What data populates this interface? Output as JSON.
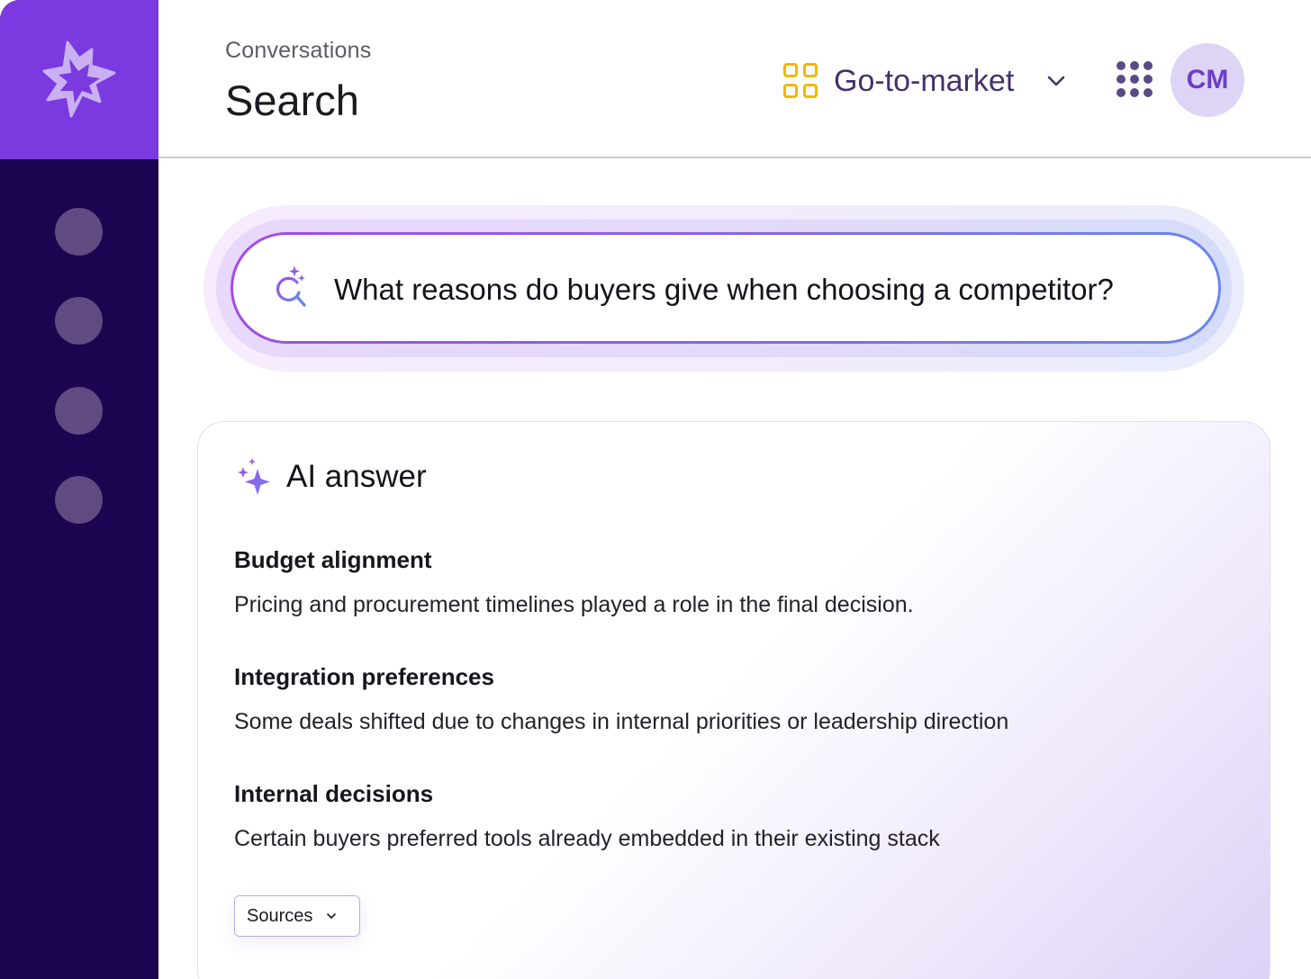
{
  "sidebar": {
    "logo": "burst-logo-icon",
    "nav_items": [
      "nav-item-1",
      "nav-item-2",
      "nav-item-3",
      "nav-item-4"
    ]
  },
  "header": {
    "breadcrumb": "Conversations",
    "title": "Search",
    "workspace": {
      "icon": "grid-squares-icon",
      "name": "Go-to-market"
    },
    "apps_icon": "dots-grid-icon",
    "avatar_initials": "CM"
  },
  "search": {
    "icon": "ai-search-icon",
    "query": "What reasons do buyers give when choosing a competitor?"
  },
  "answer": {
    "icon": "sparkle-icon",
    "title": "AI answer",
    "items": [
      {
        "title": "Budget alignment",
        "body": "Pricing and procurement timelines played a role in the final decision."
      },
      {
        "title": "Integration preferences",
        "body": "Some deals shifted due to changes in internal priorities or leadership direction"
      },
      {
        "title": "Internal decisions",
        "body": "Certain buyers preferred tools already embedded in their existing stack"
      }
    ],
    "sources_label": "Sources"
  },
  "colors": {
    "sidebar": "#1c0550",
    "brand": "#7b39e0",
    "workspace_icon": "#f2b705",
    "avatar_bg": "#ded4f5",
    "avatar_text": "#6a3ec8"
  }
}
